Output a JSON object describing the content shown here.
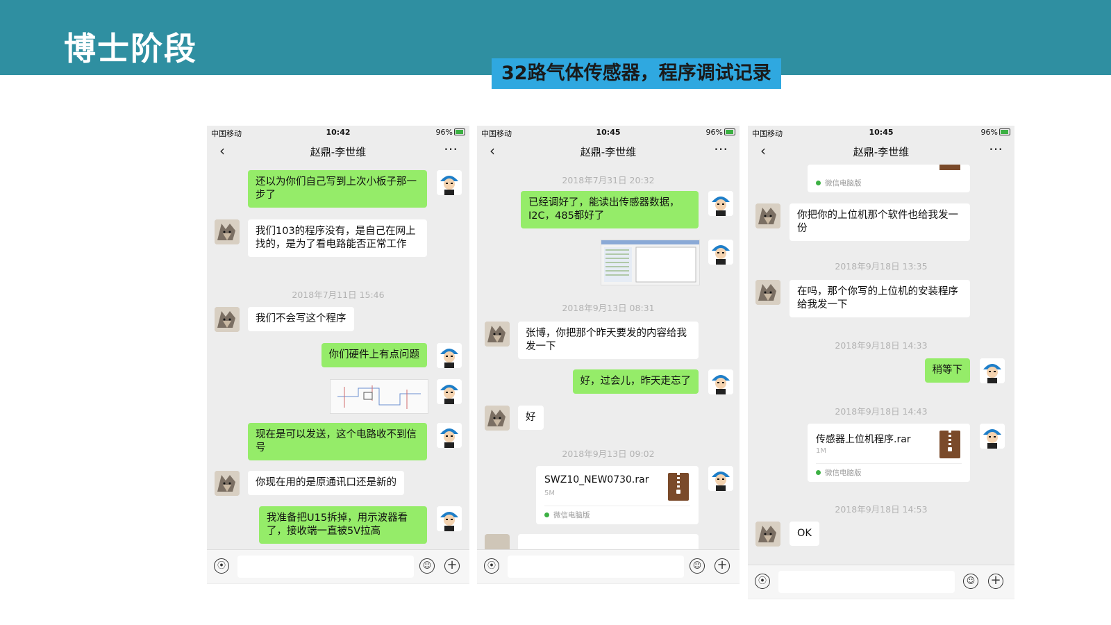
{
  "slide": {
    "title": "博士阶段",
    "subtitle": "32路气体传感器，程序调试记录"
  },
  "phones": [
    {
      "status": {
        "carrier": "中国移动",
        "time": "10:42",
        "battery": "96%"
      },
      "chat_title": "赵鼎-李世维",
      "messages": [
        {
          "text": "还以为你们自己写到上次小板子那一步了"
        },
        {
          "text": "我们103的程序没有，是自己在网上找的，是为了看电路能否正常工作"
        },
        {
          "text": "2018年7月11日 15:46"
        },
        {
          "text": "我们不会写这个程序"
        },
        {
          "text": "你们硬件上有点问题"
        },
        {
          "text": "现在是可以发送，这个电路收不到信号"
        },
        {
          "text": "你现在用的是原通讯口还是新的"
        },
        {
          "text": "我准备把U15拆掉，用示波器看了，接收端一直被5V拉高"
        }
      ]
    },
    {
      "status": {
        "carrier": "中国移动",
        "time": "10:45",
        "battery": "96%"
      },
      "chat_title": "赵鼎-李世维",
      "messages": [
        {
          "text": "2018年7月31日 20:32"
        },
        {
          "text": "已经调好了，能读出传感器数据，I2C，485都好了"
        },
        {
          "text": "2018年9月13日 08:31"
        },
        {
          "text": "张博，你把那个昨天要发的内容给我发一下"
        },
        {
          "text": "好，过会儿，昨天走忘了"
        },
        {
          "text": "好"
        },
        {
          "text": "2018年9月13日 09:02"
        }
      ],
      "file": {
        "name": "SWZ10_NEW0730.rar",
        "size": "5M",
        "source": "微信电脑版"
      }
    },
    {
      "status": {
        "carrier": "中国移动",
        "time": "10:45",
        "battery": "96%"
      },
      "chat_title": "赵鼎-李世维",
      "top_source": "微信电脑版",
      "messages": [
        {
          "text": "你把你的上位机那个软件也给我发一份"
        },
        {
          "text": "2018年9月18日 13:35"
        },
        {
          "text": "在吗，那个你写的上位机的安装程序给我发一下"
        },
        {
          "text": "2018年9月18日 14:33"
        },
        {
          "text": "稍等下"
        },
        {
          "text": "2018年9月18日 14:43"
        },
        {
          "text": "2018年9月18日 14:53"
        },
        {
          "text": "OK"
        }
      ],
      "file": {
        "name": "传感器上位机程序.rar",
        "size": "1M",
        "source": "微信电脑版"
      }
    }
  ],
  "icons": {
    "back": "chevron-left-icon",
    "more": "more-dots-icon",
    "voice": "voice-icon",
    "emoji": "emoji-icon",
    "plus": "plus-icon"
  },
  "colors": {
    "header": "#2f8fa1",
    "subtitle_bg": "#2fa8e0",
    "outgoing_bubble": "#95ec69",
    "incoming_bubble": "#ffffff",
    "chat_bg": "#ededed"
  }
}
